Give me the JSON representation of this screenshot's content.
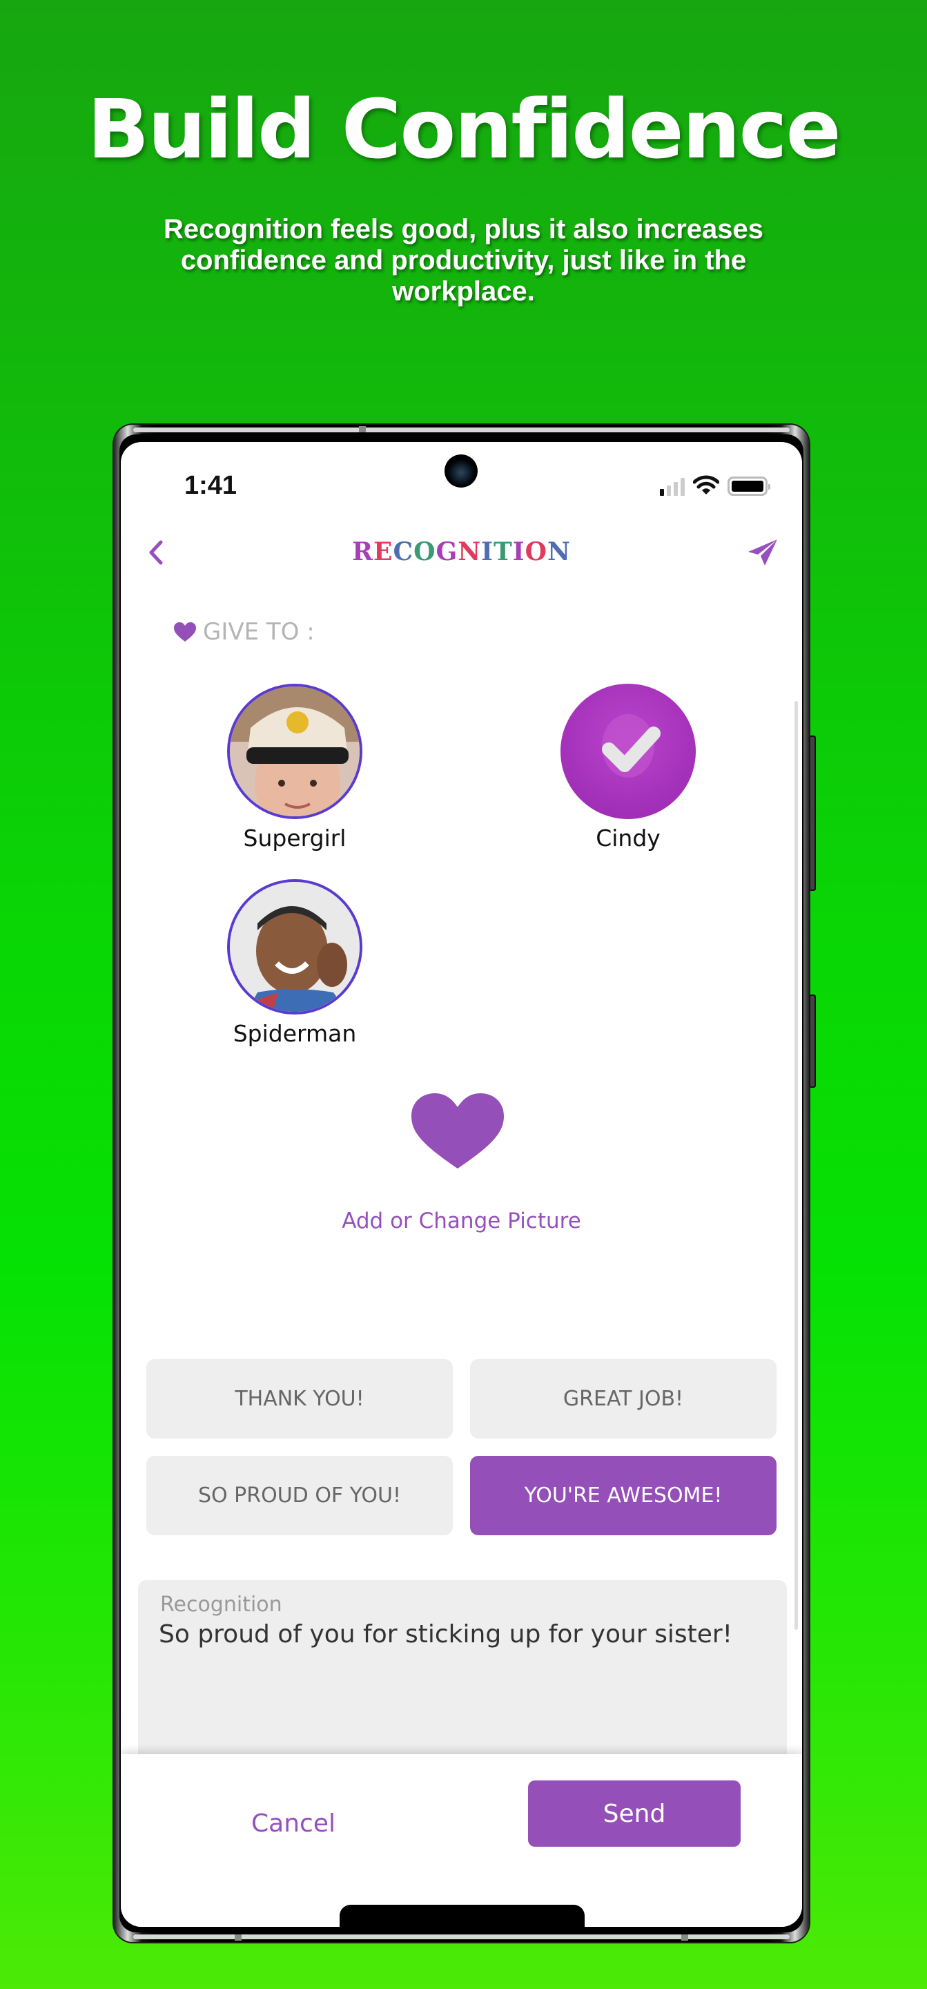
{
  "hero": {
    "title": "Build Confidence",
    "subtitle": "Recognition feels good, plus it also increases confidence and productivity, just like in the workplace."
  },
  "status_bar": {
    "time": "1:41",
    "icons": [
      "signal-icon",
      "wifi-icon",
      "battery-icon"
    ]
  },
  "header": {
    "back_icon": "chevron-left-icon",
    "title_letters": [
      {
        "ch": "R",
        "color": "#a83fb8"
      },
      {
        "ch": "E",
        "color": "#e03b5e"
      },
      {
        "ch": "C",
        "color": "#4f6db5"
      },
      {
        "ch": "O",
        "color": "#3a9a74"
      },
      {
        "ch": "G",
        "color": "#a83fb8"
      },
      {
        "ch": "N",
        "color": "#e03b5e"
      },
      {
        "ch": "I",
        "color": "#4f6db5"
      },
      {
        "ch": "T",
        "color": "#3a9a74"
      },
      {
        "ch": "I",
        "color": "#a83fb8"
      },
      {
        "ch": "O",
        "color": "#e03b5e"
      },
      {
        "ch": "N",
        "color": "#4f6db5"
      }
    ],
    "title": "RECOGNITION",
    "action_icon": "paper-plane-send-icon"
  },
  "give_to": {
    "label": "GIVE TO :",
    "recipients": [
      {
        "name": "Supergirl",
        "selected": false
      },
      {
        "name": "Cindy",
        "selected": true
      },
      {
        "name": "Spiderman",
        "selected": false
      }
    ]
  },
  "picture": {
    "icon": "heart-icon",
    "label": "Add or Change Picture"
  },
  "quick_messages": [
    {
      "label": "THANK YOU!",
      "selected": false
    },
    {
      "label": "GREAT JOB!",
      "selected": false
    },
    {
      "label": "SO PROUD OF YOU!",
      "selected": false
    },
    {
      "label": "YOU'RE AWESOME!",
      "selected": true
    }
  ],
  "recognition_field": {
    "label": "Recognition",
    "value": "So proud of you for sticking up for your sister!"
  },
  "footer": {
    "cancel_label": "Cancel",
    "send_label": "Send"
  },
  "colors": {
    "accent": "#954fb8",
    "avatar_ring": "#5a3bd0",
    "selected_overlay": "#a22fb8",
    "button_bg": "#eeeeee"
  }
}
